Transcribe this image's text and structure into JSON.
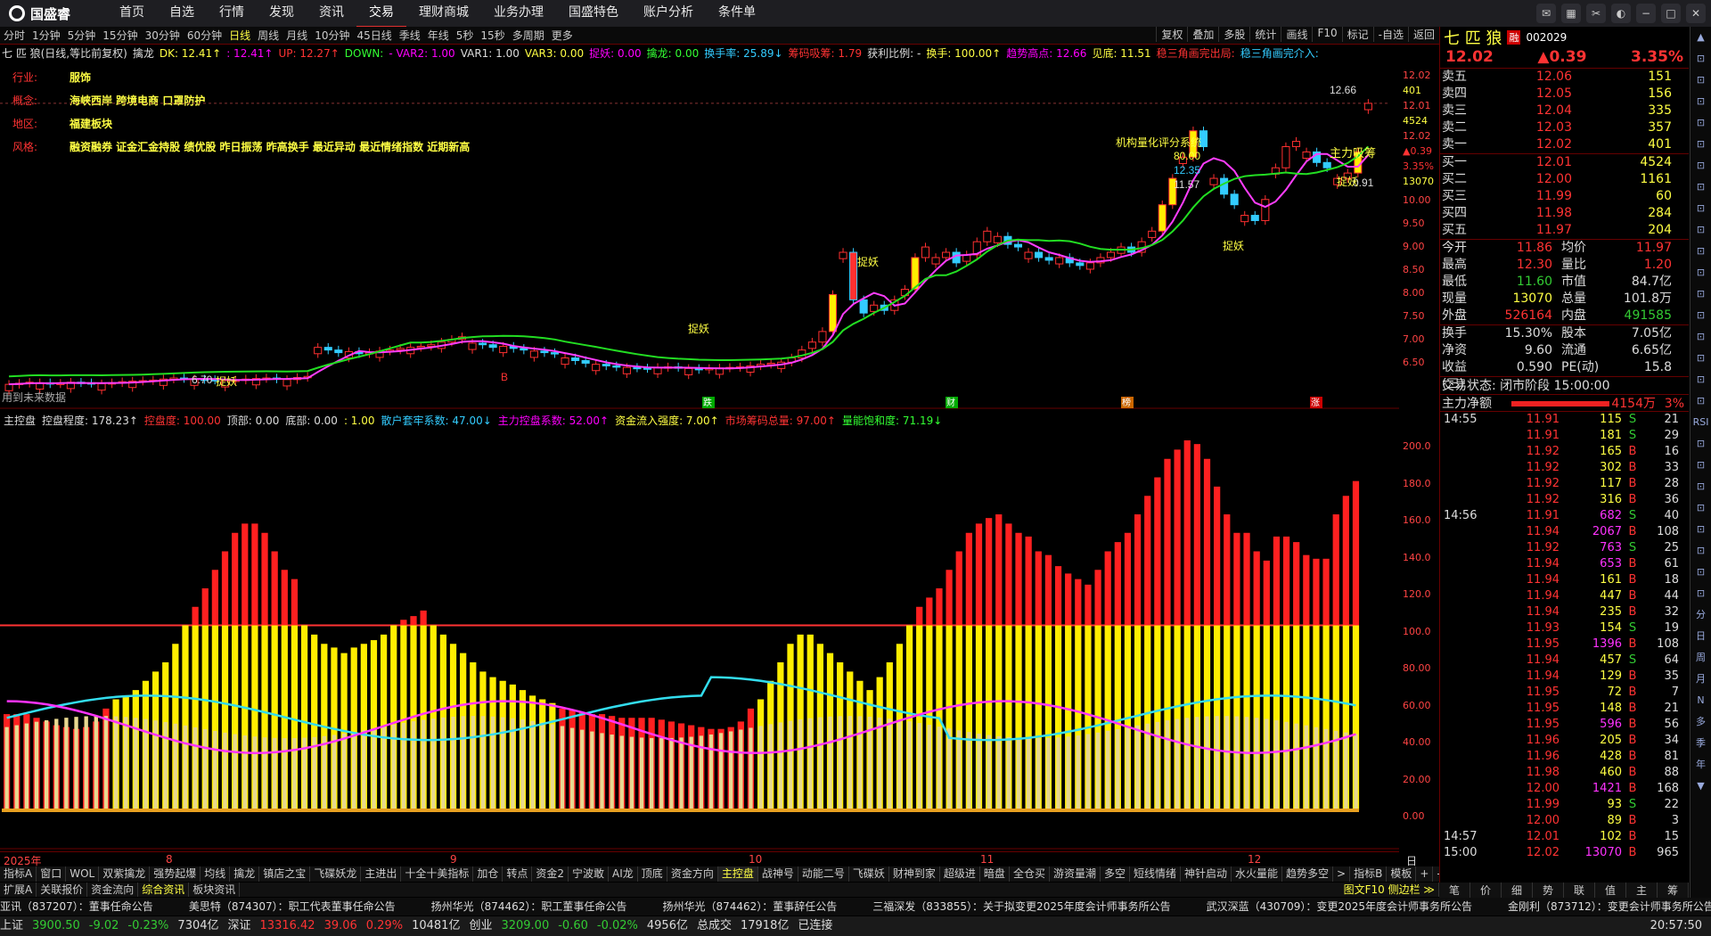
{
  "app": {
    "logo": "国盛睿",
    "menu": [
      "首页",
      "自选",
      "行情",
      "发现",
      "资讯",
      "交易",
      "理财商城",
      "业务办理",
      "国盛特色",
      "账户分析",
      "条件单"
    ],
    "active_menu": "交易"
  },
  "period": {
    "items": [
      "分时",
      "1分钟",
      "5分钟",
      "15分钟",
      "30分钟",
      "60分钟",
      "日线",
      "周线",
      "月线",
      "10分钟",
      "45日线",
      "季线",
      "年线",
      "5秒",
      "15秒",
      "多周期",
      "更多"
    ],
    "active": "日线",
    "tools": [
      "复权",
      "叠加",
      "多股",
      "统计",
      "画线",
      "F10",
      "标记",
      "-自选",
      "返回"
    ]
  },
  "indicators": {
    "title": "七 匹 狼(日线,等比前复权)",
    "items": [
      {
        "t": "擒龙",
        "c": "wt"
      },
      {
        "t": "DK: 12.41↑",
        "c": "yl"
      },
      {
        "t": ": 12.41↑",
        "c": "mg"
      },
      {
        "t": "UP: 12.27↑",
        "c": "up"
      },
      {
        "t": "DOWN:",
        "c": "gr"
      },
      {
        "t": "- VAR2: 1.00",
        "c": "mg"
      },
      {
        "t": "VAR1: 1.00",
        "c": "wt"
      },
      {
        "t": "VAR3: 0.00",
        "c": "yl"
      },
      {
        "t": "捉妖: 0.00",
        "c": "mg"
      },
      {
        "t": "擒龙: 0.00",
        "c": "gr"
      },
      {
        "t": "换手率: 25.89↓",
        "c": "cy"
      },
      {
        "t": "筹码吸筹: 1.79",
        "c": "up"
      },
      {
        "t": "获利比例: -",
        "c": "wt"
      },
      {
        "t": "换手: 100.00↑",
        "c": "yl"
      },
      {
        "t": "趋势高点: 12.66",
        "c": "mg"
      },
      {
        "t": "见底: 11.51",
        "c": "yl"
      },
      {
        "t": "稳三角画完出局:",
        "c": "up"
      },
      {
        "t": "稳三角画完介入:",
        "c": "cy"
      }
    ]
  },
  "stock_info": [
    {
      "k": "行业:",
      "v": "服饰"
    },
    {
      "k": "概念:",
      "v": "海峡西岸 跨境电商 口罩防护"
    },
    {
      "k": "地区:",
      "v": "福建板块"
    },
    {
      "k": "风格:",
      "v": "融资融券 证金汇金持股 绩优股 昨日振荡 昨高换手 最近异动 最近情绪指数 近期新高"
    }
  ],
  "main_axis": [
    "12.02",
    "401",
    "12.01",
    "4524",
    "12.02",
    "▲0.39",
    "3.35%",
    "13070",
    "10.00",
    "9.50",
    "9.00",
    "8.50",
    "8.00",
    "7.50",
    "7.00",
    "6.50"
  ],
  "main_annotations": {
    "high_label": "12.66",
    "low_label": "6.70",
    "future": "用到未来数据",
    "quant": "机构量化评分系统",
    "score": "80.00",
    "strength": "12.35",
    "profit": "11.57",
    "zhuli": "主力吸筹",
    "val091": "0.91",
    "tiyao": "捉妖",
    "b_label": "B",
    "bottom_icons": [
      "跌",
      "财",
      "榜",
      "涨"
    ]
  },
  "sub": {
    "title": "主控盘",
    "items": [
      {
        "t": "控盘程度: 178.23↑",
        "c": "wt"
      },
      {
        "t": "控盘度: 100.00",
        "c": "up"
      },
      {
        "t": "顶部: 0.00",
        "c": "wt"
      },
      {
        "t": "底部: 0.00",
        "c": "wt"
      },
      {
        "t": ": 1.00",
        "c": "yl"
      },
      {
        "t": "散户套牢系数: 47.00↓",
        "c": "cy"
      },
      {
        "t": "主力控盘系数: 52.00↑",
        "c": "mg"
      },
      {
        "t": "资金流入强度: 7.00↑",
        "c": "yl"
      },
      {
        "t": "市场筹码总量: 97.00↑",
        "c": "up"
      },
      {
        "t": "量能饱和度: 71.19↓",
        "c": "gr"
      }
    ],
    "axis": [
      "200.0",
      "180.0",
      "160.0",
      "140.0",
      "120.0",
      "100.0",
      "80.00",
      "60.00",
      "40.00",
      "20.00",
      "0.00"
    ]
  },
  "dates": [
    "2025年",
    "8",
    "9",
    "10",
    "11",
    "12"
  ],
  "date_right": "日线",
  "tabs": [
    "指标A",
    "窗口",
    "WOL",
    "双紫擒龙",
    "强势起爆",
    "均线",
    "擒龙",
    "镇店之宝",
    "飞碟妖龙",
    "主进出",
    "十全十美指标",
    "加仓",
    "转点",
    "资金2",
    "宁波敢",
    "AI龙",
    "顶底",
    "资金方向",
    "主控盘",
    "战神号",
    "动能二号",
    "飞碟妖",
    "财神到家",
    "超级进",
    "暗盘",
    "全仓买",
    "游资量潮",
    "多空",
    "短线情绪",
    "神针启动",
    "水火量能",
    "趋势多空",
    ">",
    "指标B",
    "模板",
    "+",
    "-"
  ],
  "active_tab": "主控盘",
  "tabs2": [
    "扩展A",
    "关联报价",
    "资金流向",
    "综合资讯",
    "板块资讯"
  ],
  "active_tab2": "综合资讯",
  "tabs2_right": "图文F10 侧边栏 ≫",
  "news": [
    "亚讯（837207）：董事任命公告",
    "美思特（874307）：职工代表董事任命公告",
    "扬州华光（874462）：职工董事任命公告",
    "扬州华光（874462）：董事辞任公告",
    "三福深发（833855）：关于拟变更2025年度会计师事务所公告",
    "武汉深蓝（430709）：变更2025年度会计师事务所公告",
    "金刚利（873712）：变更会计师事务所公告"
  ],
  "status": {
    "sh_label": "上证",
    "sh": "3900.50",
    "sh_chg": "-9.02",
    "sh_pct": "-0.23%",
    "sh_amt": "7304亿",
    "sz_label": "深证",
    "sz": "13316.42",
    "sz_chg": "39.06",
    "sz_pct": "0.29%",
    "sz_amt": "10481亿",
    "cy_label": "创业",
    "cy": "3209.00",
    "cy_chg": "-0.60",
    "cy_pct": "-0.02%",
    "cy_amt": "4956亿",
    "total_label": "总成交",
    "total": "17918亿",
    "conn": "已连接",
    "time": "20:57:50"
  },
  "quote": {
    "name": "七 匹 狼",
    "badge": "融",
    "code": "002029",
    "price": "12.02",
    "chg": "▲0.39",
    "pct": "3.35%",
    "sell": [
      {
        "l": "卖五",
        "p": "12.06",
        "q": "151"
      },
      {
        "l": "卖四",
        "p": "12.05",
        "q": "156"
      },
      {
        "l": "卖三",
        "p": "12.04",
        "q": "335"
      },
      {
        "l": "卖二",
        "p": "12.03",
        "q": "357"
      },
      {
        "l": "卖一",
        "p": "12.02",
        "q": "401"
      }
    ],
    "buy": [
      {
        "l": "买一",
        "p": "12.01",
        "q": "4524"
      },
      {
        "l": "买二",
        "p": "12.00",
        "q": "1161"
      },
      {
        "l": "买三",
        "p": "11.99",
        "q": "60"
      },
      {
        "l": "买四",
        "p": "11.98",
        "q": "284"
      },
      {
        "l": "买五",
        "p": "11.97",
        "q": "204"
      }
    ],
    "stats": [
      {
        "a": "今开",
        "b": "11.86",
        "bc": "up",
        "c": "均价",
        "d": "11.97",
        "dc": "up"
      },
      {
        "a": "最高",
        "b": "12.30",
        "bc": "up",
        "c": "量比",
        "d": "1.20",
        "dc": "up"
      },
      {
        "a": "最低",
        "b": "11.60",
        "bc": "dn",
        "c": "市值",
        "d": "84.7亿",
        "dc": "wt"
      },
      {
        "a": "现量",
        "b": "13070",
        "bc": "yl",
        "c": "总量",
        "d": "101.8万",
        "dc": "wt"
      },
      {
        "a": "外盘",
        "b": "526164",
        "bc": "up",
        "c": "内盘",
        "d": "491585",
        "dc": "dn"
      }
    ],
    "stats2": [
      {
        "a": "换手",
        "b": "15.30%",
        "c": "股本",
        "d": "7.05亿"
      },
      {
        "a": "净资",
        "b": "9.60",
        "c": "流通",
        "d": "6.65亿"
      },
      {
        "a": "收益(三)",
        "b": "0.590",
        "c": "PE(动)",
        "d": "15.8"
      }
    ],
    "trade_state": "交易状态: 闭市阶段 15:00:00",
    "flow_label": "主力净额",
    "flow_val": "4154万",
    "flow_pct": "3%"
  },
  "ticks": [
    {
      "t": "14:55",
      "p": "11.91",
      "v": "115",
      "s": "S",
      "n": "21"
    },
    {
      "t": "",
      "p": "11.91",
      "v": "181",
      "s": "S",
      "n": "29"
    },
    {
      "t": "",
      "p": "11.92",
      "v": "165",
      "s": "B",
      "n": "16"
    },
    {
      "t": "",
      "p": "11.92",
      "v": "302",
      "s": "B",
      "n": "33"
    },
    {
      "t": "",
      "p": "11.92",
      "v": "117",
      "s": "B",
      "n": "28"
    },
    {
      "t": "",
      "p": "11.92",
      "v": "316",
      "s": "B",
      "n": "36"
    },
    {
      "t": "14:56",
      "p": "11.91",
      "v": "682",
      "s": "S",
      "n": "40"
    },
    {
      "t": "",
      "p": "11.94",
      "v": "2067",
      "s": "B",
      "n": "108"
    },
    {
      "t": "",
      "p": "11.92",
      "v": "763",
      "s": "S",
      "n": "25"
    },
    {
      "t": "",
      "p": "11.94",
      "v": "653",
      "s": "B",
      "n": "61"
    },
    {
      "t": "",
      "p": "11.94",
      "v": "161",
      "s": "B",
      "n": "18"
    },
    {
      "t": "",
      "p": "11.94",
      "v": "447",
      "s": "B",
      "n": "44"
    },
    {
      "t": "",
      "p": "11.94",
      "v": "235",
      "s": "B",
      "n": "32"
    },
    {
      "t": "",
      "p": "11.93",
      "v": "154",
      "s": "S",
      "n": "19"
    },
    {
      "t": "",
      "p": "11.95",
      "v": "1396",
      "s": "B",
      "n": "108"
    },
    {
      "t": "",
      "p": "11.94",
      "v": "457",
      "s": "S",
      "n": "64"
    },
    {
      "t": "",
      "p": "11.94",
      "v": "129",
      "s": "B",
      "n": "35"
    },
    {
      "t": "",
      "p": "11.95",
      "v": "72",
      "s": "B",
      "n": "7"
    },
    {
      "t": "",
      "p": "11.95",
      "v": "148",
      "s": "B",
      "n": "21"
    },
    {
      "t": "",
      "p": "11.95",
      "v": "596",
      "s": "B",
      "n": "56"
    },
    {
      "t": "",
      "p": "11.96",
      "v": "205",
      "s": "B",
      "n": "34"
    },
    {
      "t": "",
      "p": "11.96",
      "v": "428",
      "s": "B",
      "n": "81"
    },
    {
      "t": "",
      "p": "11.98",
      "v": "460",
      "s": "B",
      "n": "88"
    },
    {
      "t": "",
      "p": "12.00",
      "v": "1421",
      "s": "B",
      "n": "168"
    },
    {
      "t": "",
      "p": "11.99",
      "v": "93",
      "s": "S",
      "n": "22"
    },
    {
      "t": "",
      "p": "12.00",
      "v": "89",
      "s": "B",
      "n": "3"
    },
    {
      "t": "14:57",
      "p": "12.01",
      "v": "102",
      "s": "B",
      "n": "15"
    },
    {
      "t": "15:00",
      "p": "12.02",
      "v": "13070",
      "s": "B",
      "n": "965"
    }
  ],
  "rbottom": [
    "笔",
    "价",
    "细",
    "势",
    "联",
    "值",
    "主",
    "筹"
  ],
  "sidebar": [
    "▲",
    "⊡",
    "⊡",
    "⊡",
    "⊡",
    "⊡",
    "⊡",
    "⊡",
    "⊡",
    "⊡",
    "⊡",
    "⊡",
    "⊡",
    "⊡",
    "⊡",
    "⊡",
    "⊡",
    "⊡",
    "RSI",
    "⊡",
    "⊡",
    "⊡",
    "⊡",
    "⊡",
    "⊡",
    "⊡",
    "⊡",
    "分",
    "日",
    "周",
    "月",
    "N",
    "多",
    "季",
    "年",
    "▼"
  ],
  "colors": {
    "up": "#ff3333",
    "down": "#33cc33",
    "yellow": "#ffff44",
    "cyan": "#33ccff",
    "magenta": "#ff33ff",
    "bg": "#000000"
  },
  "chart_data": {
    "type": "candlestick",
    "series": [
      {
        "name": "close",
        "values": [
          6.7,
          6.72,
          6.74,
          6.73,
          6.71,
          6.72,
          6.74,
          6.73,
          6.72,
          6.71,
          6.73,
          6.75,
          6.76,
          6.77,
          6.78,
          6.8,
          6.82,
          6.81,
          6.8,
          6.79,
          6.78,
          6.77,
          6.78,
          6.8,
          6.81,
          6.82,
          6.8,
          6.79,
          6.83,
          6.85,
          7.4,
          7.35,
          7.3,
          7.32,
          7.28,
          7.3,
          7.33,
          7.35,
          7.38,
          7.4,
          7.42,
          7.45,
          7.5,
          7.55,
          7.6,
          7.48,
          7.45,
          7.4,
          7.42,
          7.38,
          7.35,
          7.33,
          7.3,
          7.28,
          7.2,
          7.15,
          7.1,
          7.08,
          7.05,
          7.03,
          7.02,
          7.01,
          7.0,
          7.02,
          7.03,
          7.02,
          7.0,
          6.98,
          7.0,
          7.01,
          7.02,
          7.03,
          7.05,
          7.08,
          7.1,
          7.12,
          7.2,
          7.35,
          7.5,
          7.7,
          8.4,
          9.2,
          8.3,
          8.05,
          8.2,
          8.1,
          8.3,
          8.5,
          9.1,
          9.3,
          9.1,
          9.2,
          9.0,
          9.15,
          9.4,
          9.6,
          9.5,
          9.35,
          9.3,
          9.2,
          9.1,
          9.05,
          9.1,
          9.0,
          8.95,
          9.0,
          9.1,
          9.2,
          9.3,
          9.2,
          9.4,
          9.6,
          10.1,
          10.6,
          11.0,
          11.5,
          11.2,
          10.6,
          10.3,
          10.1,
          9.9,
          9.8,
          10.2,
          10.8,
          11.2,
          11.3,
          11.1,
          10.9,
          10.8,
          10.6,
          10.7,
          11.1,
          12.02
        ]
      }
    ],
    "ylim": [
      6.5,
      12.66
    ]
  }
}
